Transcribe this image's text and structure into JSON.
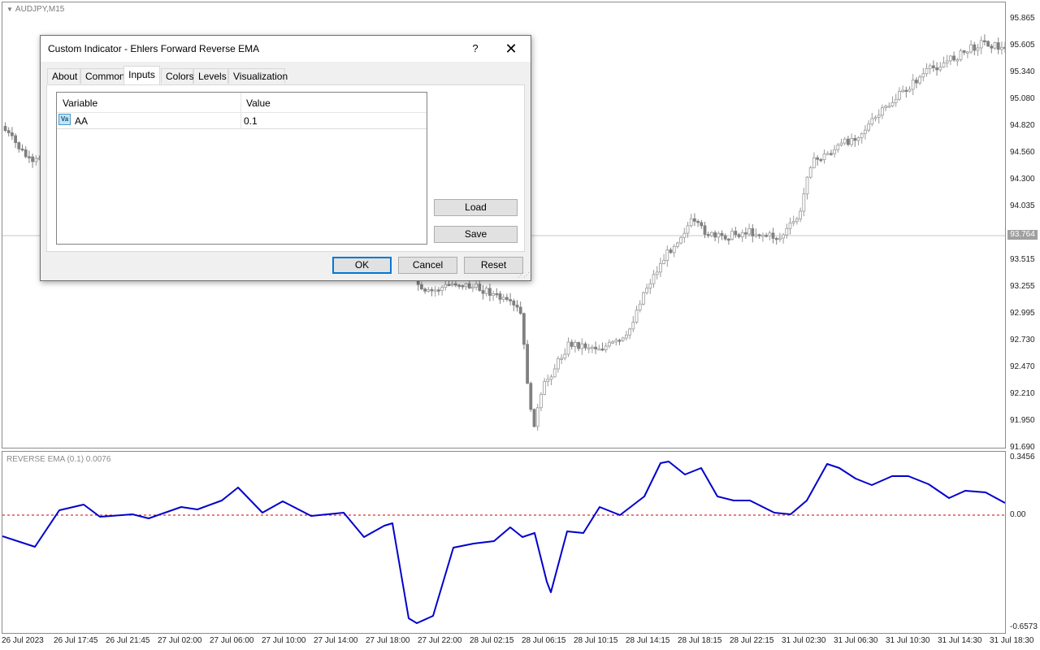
{
  "chart": {
    "symbol_title": "AUDJPY,M15",
    "price_labels": [
      "95.865",
      "95.605",
      "95.340",
      "95.080",
      "94.820",
      "94.560",
      "94.300",
      "94.035",
      "93.515",
      "93.255",
      "92.995",
      "92.730",
      "92.470",
      "92.210",
      "91.950",
      "91.690"
    ],
    "current_price": "93.764",
    "candle_bull_color": "#ffffff",
    "candle_bear_color": "#808080",
    "candle_outline_color": "#9a9a9a"
  },
  "indicator": {
    "title": "REVERSE EMA (0.1) 0.0076",
    "scale_labels": [
      "0.3456",
      "0.00",
      "-0.6573"
    ],
    "line_color": "#0000cc",
    "zero_line_color": "#cc0000"
  },
  "time_axis": {
    "labels": [
      "26 Jul 2023",
      "26 Jul 17:45",
      "26 Jul 21:45",
      "27 Jul 02:00",
      "27 Jul 06:00",
      "27 Jul 10:00",
      "27 Jul 14:00",
      "27 Jul 18:00",
      "27 Jul 22:00",
      "28 Jul 02:15",
      "28 Jul 06:15",
      "28 Jul 10:15",
      "28 Jul 14:15",
      "28 Jul 18:15",
      "28 Jul 22:15",
      "31 Jul 02:30",
      "31 Jul 06:30",
      "31 Jul 10:30",
      "31 Jul 14:30",
      "31 Jul 18:30"
    ]
  },
  "dialog": {
    "title": "Custom Indicator - Ehlers Forward Reverse EMA",
    "help_label": "?",
    "close_label": "✕",
    "tabs": [
      {
        "label": "About",
        "active": false
      },
      {
        "label": "Common",
        "active": false
      },
      {
        "label": "Inputs",
        "active": true
      },
      {
        "label": "Colors",
        "active": false
      },
      {
        "label": "Levels",
        "active": false
      },
      {
        "label": "Visualization",
        "active": false
      }
    ],
    "inputs_table": {
      "headers": {
        "variable": "Variable",
        "value": "Value"
      },
      "rows": [
        {
          "icon": "variable-icon",
          "icon_text": "Va",
          "variable": "AA",
          "value": "0.1"
        }
      ]
    },
    "buttons": {
      "load": "Load",
      "save": "Save",
      "ok": "OK",
      "cancel": "Cancel",
      "reset": "Reset"
    }
  }
}
